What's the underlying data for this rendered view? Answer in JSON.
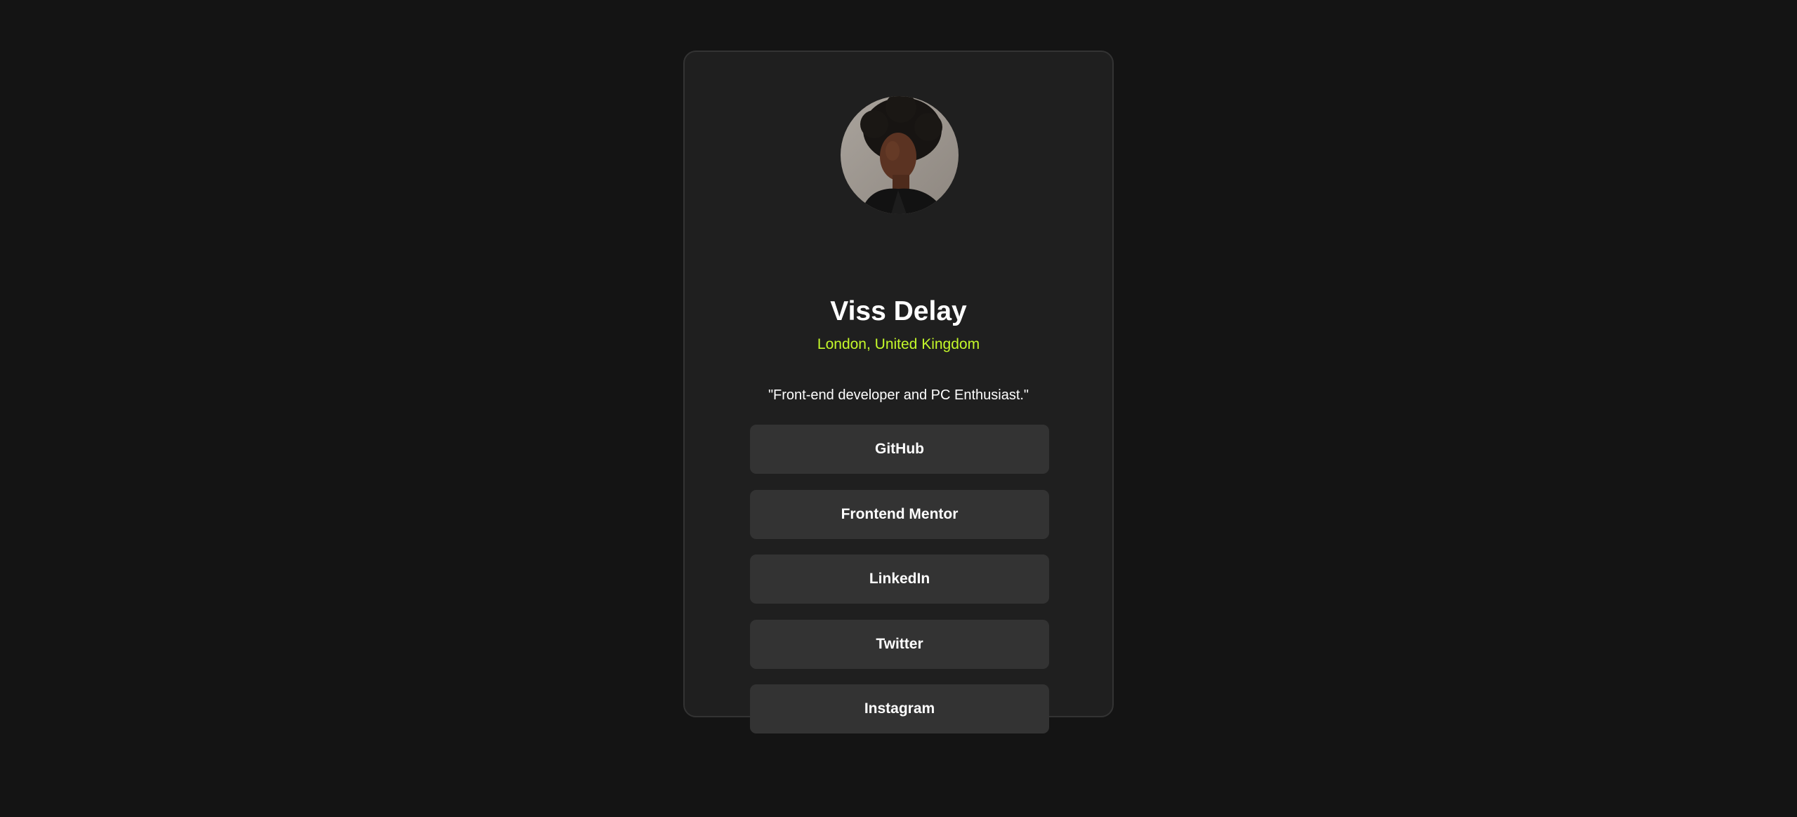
{
  "profile": {
    "name": "Viss Delay",
    "location": "London, United Kingdom",
    "bio": "\"Front-end developer and PC Enthusiast.\""
  },
  "links": [
    {
      "label": "GitHub"
    },
    {
      "label": "Frontend Mentor"
    },
    {
      "label": "LinkedIn"
    },
    {
      "label": "Twitter"
    },
    {
      "label": "Instagram"
    }
  ],
  "colors": {
    "page_background": "#141414",
    "card_background": "#1f1f1f",
    "button_background": "#333333",
    "accent": "#c4f82a",
    "text": "#ffffff"
  }
}
